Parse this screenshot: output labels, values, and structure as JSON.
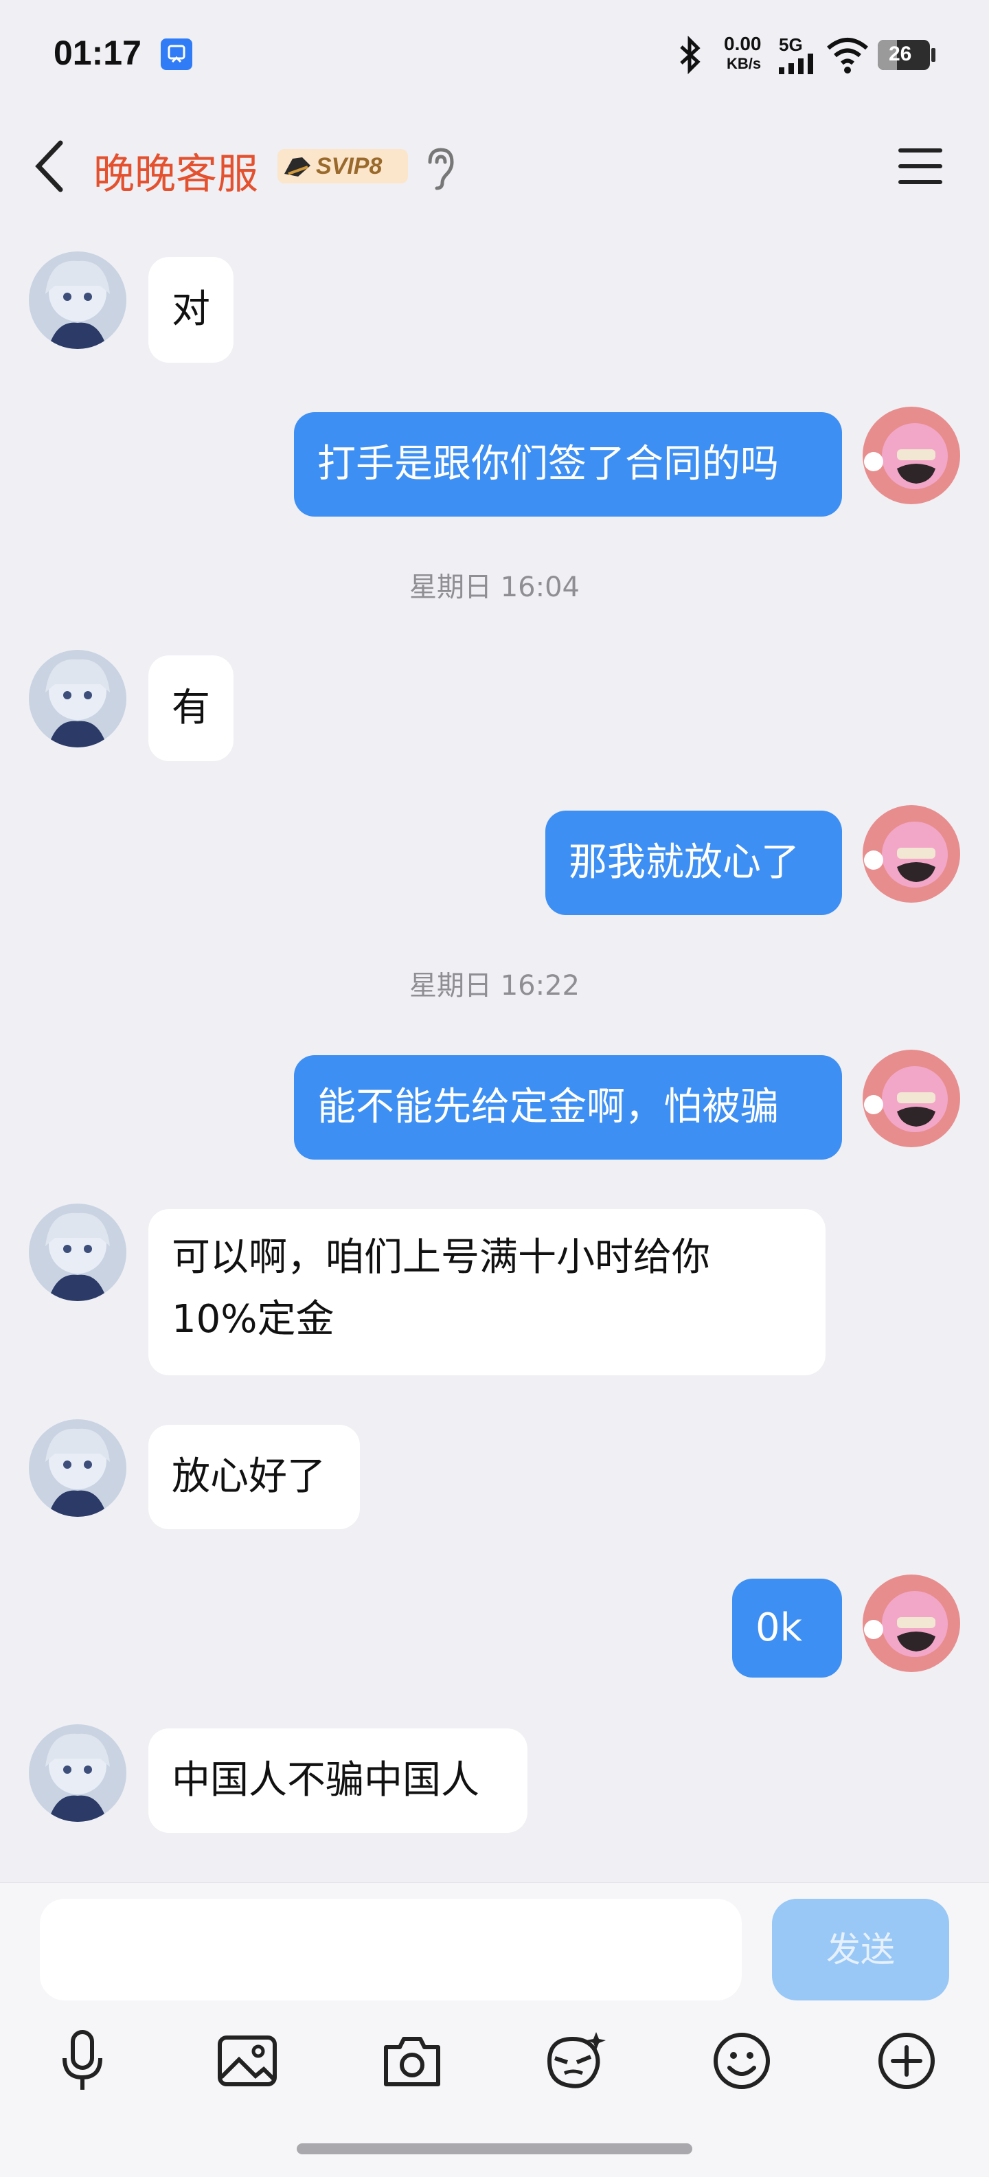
{
  "status": {
    "time": "01:17",
    "net_speed_value": "0.00",
    "net_speed_unit": "KB/s",
    "network": "5G",
    "battery": "26"
  },
  "header": {
    "title": "晚晚客服",
    "badge": "SVIP8"
  },
  "messages": [
    {
      "side": "in",
      "text": "对"
    },
    {
      "side": "out",
      "text": "打手是跟你们签了合同的吗"
    },
    {
      "timestamp": "星期日 16:04"
    },
    {
      "side": "in",
      "text": "有"
    },
    {
      "side": "out",
      "text": "那我就放心了"
    },
    {
      "timestamp": "星期日 16:22"
    },
    {
      "side": "out",
      "text": "能不能先给定金啊，怕被骗"
    },
    {
      "side": "in",
      "text_line1": "可以啊，咱们上号满十小时给你",
      "text_line2": "10%定金"
    },
    {
      "side": "in",
      "text": "放心好了"
    },
    {
      "side": "out",
      "text": "0k"
    },
    {
      "side": "in",
      "text": "中国人不骗中国人"
    }
  ],
  "composer": {
    "input_value": "",
    "send_label": "发送",
    "tools": [
      "microphone-icon",
      "image-icon",
      "camera-icon",
      "sticker-icon",
      "emoji-icon",
      "plus-icon"
    ]
  },
  "colors": {
    "outgoing_bubble": "#3d8ff3",
    "incoming_bubble": "#ffffff",
    "title": "#e4512f",
    "send_button": "#99c8f6"
  }
}
